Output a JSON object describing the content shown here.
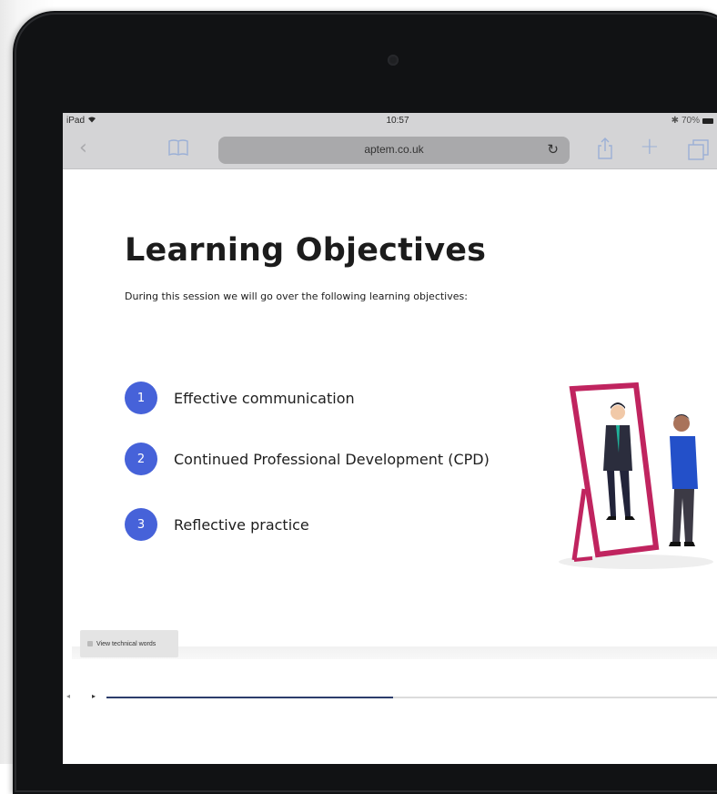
{
  "status_bar": {
    "device": "iPad",
    "time": "10:57",
    "battery": "70%"
  },
  "browser": {
    "url": "aptem.co.uk",
    "back_icon": "chevron-left-icon",
    "bookmarks_icon": "book-icon",
    "reload_icon": "reload-icon",
    "share_icon": "share-icon",
    "new_tab_icon": "plus-icon",
    "tabs_icon": "tabs-icon"
  },
  "slide": {
    "title": "Learning Objectives",
    "subtitle": "During this session we will go over the following learning objectives:",
    "objectives": [
      {
        "number": "1",
        "label": "Effective communication"
      },
      {
        "number": "2",
        "label": "Continued Professional Development (CPD)"
      },
      {
        "number": "3",
        "label": "Reflective practice"
      }
    ],
    "accent_color": "#4662d9",
    "mirror_color": "#c0245f"
  },
  "footer": {
    "view_button_label": "View technical words"
  },
  "player": {
    "progress": 0.47,
    "progress_color": "#2c3d6b"
  }
}
